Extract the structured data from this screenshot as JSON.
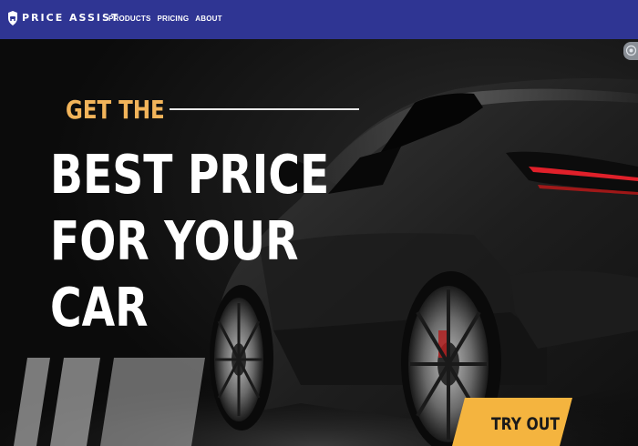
{
  "nav": {
    "brand": "PRICE ASSIST",
    "brand_icon": "shield-car-icon",
    "items": [
      {
        "label": "PRODUCTS"
      },
      {
        "label": "PRICING"
      },
      {
        "label": "ABOUT"
      }
    ]
  },
  "hero": {
    "eyebrow": "GET THE",
    "headline_lines": [
      "BEST PRICE",
      "FOR YOUR",
      "CAR"
    ],
    "cta_label": "TRY OUT",
    "corner_icon": "settings-icon"
  },
  "colors": {
    "nav_bg": "#2f3593",
    "accent": "#f2b45a",
    "cta_bg": "#f4b43f",
    "hero_bg": "#121212"
  }
}
